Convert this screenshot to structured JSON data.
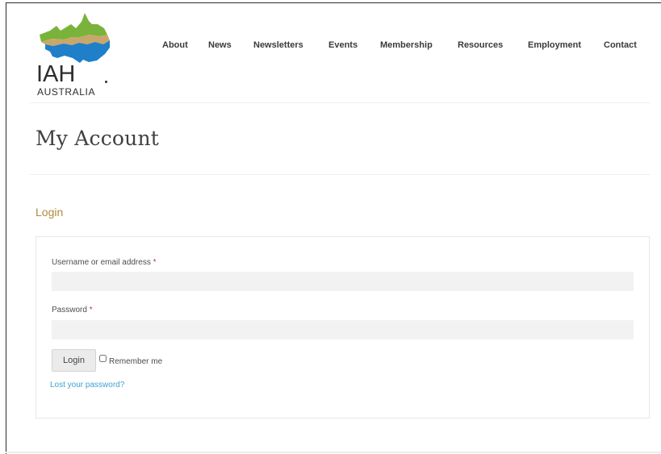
{
  "site": {
    "logo_text": "IAH",
    "logo_subtext": "AUSTRALIA",
    "logo_icon": "iah-australia-logo-icon",
    "colors": {
      "logo_green": "#79b33b",
      "logo_tan": "#c9a76a",
      "logo_blue": "#1f7fc9",
      "heading_gold": "#b08a3c",
      "link_blue": "#3ea1d1",
      "required_red": "#c0392b"
    }
  },
  "nav": {
    "items": [
      {
        "label": "About"
      },
      {
        "label": "News"
      },
      {
        "label": "Newsletters"
      },
      {
        "label": "Events"
      },
      {
        "label": "Membership"
      },
      {
        "label": "Resources"
      },
      {
        "label": "Employment"
      },
      {
        "label": "Contact"
      }
    ]
  },
  "page": {
    "title": "My Account"
  },
  "login": {
    "heading": "Login",
    "username_label": "Username or email address",
    "username_value": "",
    "password_label": "Password",
    "password_value": "",
    "required_marker": "*",
    "submit_label": "Login",
    "remember_label": "Remember me",
    "remember_checked": false,
    "lost_password_link": "Lost your password?"
  }
}
